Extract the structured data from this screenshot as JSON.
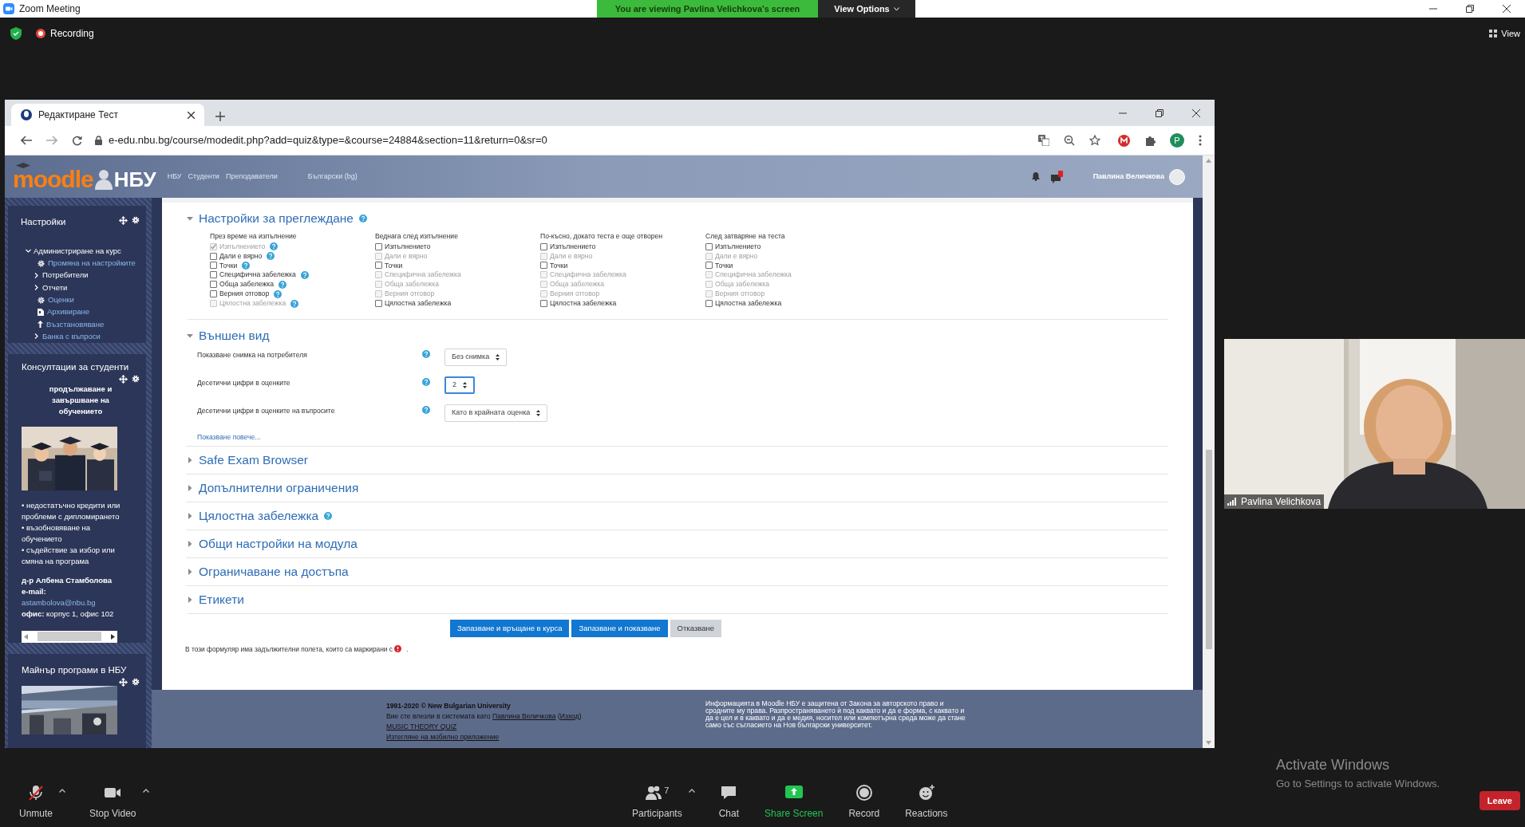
{
  "zoom": {
    "title": "Zoom Meeting",
    "banner": "You are viewing Pavlina Velichkova's screen",
    "view_options": "View Options",
    "recording": "Recording",
    "view": "View"
  },
  "browser": {
    "tab": "Редактиране Тест",
    "url": "e-edu.nbu.bg/course/modedit.php?add=quiz&type=&course=24884&section=11&return=0&sr=0",
    "profile": "P"
  },
  "moodle": {
    "logo": "moodle",
    "logo_suffix": "НБУ",
    "nav": [
      "НБУ",
      "Студенти",
      "Преподаватели"
    ],
    "language": "Български (bg)",
    "user": "Павлина Величкова"
  },
  "sidebar": {
    "settings": {
      "title": "Настройки",
      "root": {
        "label": "Администриране на курс",
        "expanded": true,
        "children": [
          {
            "label": "Промяна на настройките",
            "kind": "settings"
          },
          {
            "label": "Потребители",
            "kind": "branch",
            "linked": false
          },
          {
            "label": "Отчети",
            "kind": "branch",
            "linked": false
          },
          {
            "label": "Оценки",
            "kind": "settings"
          },
          {
            "label": "Архивиране",
            "kind": "backup"
          },
          {
            "label": "Възстановяване",
            "kind": "restore"
          },
          {
            "label": "Банка с въпроси",
            "kind": "branch",
            "linked": true
          }
        ]
      }
    },
    "consult": {
      "title": "Консултации за студенти",
      "heading": "продължаване и завършване на обучението",
      "bullets": [
        "• недостатъчно кредити или проблеми с дипломирането",
        "• възобновяване на обучението",
        "• съдействие за избор или смяна на програма"
      ],
      "name": "д-р Албена Стамболова",
      "email_label": "e-mail:",
      "email": "astambolova@nbu.bg",
      "office": "**офис:** корпус 1, офис 102"
    },
    "minor": {
      "title": "Майнър програми в НБУ"
    }
  },
  "review": {
    "title": "Настройки за преглеждане",
    "expanded": true,
    "help": true,
    "columns": [
      {
        "heading": "През време на изпълнение",
        "items": [
          {
            "label": "Изпълнението",
            "checked": true,
            "disabled": true,
            "help": true
          },
          {
            "label": "Дали е вярно",
            "checked": false,
            "disabled": false,
            "help": true
          },
          {
            "label": "Точки",
            "checked": false,
            "disabled": false,
            "help": true
          },
          {
            "label": "Специфична забележка",
            "checked": false,
            "disabled": false,
            "help": true
          },
          {
            "label": "Обща забележка",
            "checked": false,
            "disabled": false,
            "help": true
          },
          {
            "label": "Верния отговор",
            "checked": false,
            "disabled": false,
            "help": true
          },
          {
            "label": "Цялостна забележка",
            "checked": false,
            "disabled": true,
            "help": true
          }
        ]
      },
      {
        "heading": "Веднага след изпълнение",
        "items": [
          {
            "label": "Изпълнението",
            "checked": false,
            "disabled": false,
            "help": false
          },
          {
            "label": "Дали е вярно",
            "checked": false,
            "disabled": true,
            "help": false
          },
          {
            "label": "Точки",
            "checked": false,
            "disabled": false,
            "help": false
          },
          {
            "label": "Специфична забележка",
            "checked": false,
            "disabled": true,
            "help": false
          },
          {
            "label": "Обща забележка",
            "checked": false,
            "disabled": true,
            "help": false
          },
          {
            "label": "Верния отговор",
            "checked": false,
            "disabled": true,
            "help": false
          },
          {
            "label": "Цялостна забележка",
            "checked": false,
            "disabled": false,
            "help": false
          }
        ]
      },
      {
        "heading": "По-късно, докато теста е още отворен",
        "items": [
          {
            "label": "Изпълнението",
            "checked": false,
            "disabled": false,
            "help": false
          },
          {
            "label": "Дали е вярно",
            "checked": false,
            "disabled": true,
            "help": false
          },
          {
            "label": "Точки",
            "checked": false,
            "disabled": false,
            "help": false
          },
          {
            "label": "Специфична забележка",
            "checked": false,
            "disabled": true,
            "help": false
          },
          {
            "label": "Обща забележка",
            "checked": false,
            "disabled": true,
            "help": false
          },
          {
            "label": "Верния отговор",
            "checked": false,
            "disabled": true,
            "help": false
          },
          {
            "label": "Цялостна забележка",
            "checked": false,
            "disabled": false,
            "help": false
          }
        ]
      },
      {
        "heading": "След затваряне на теста",
        "items": [
          {
            "label": "Изпълнението",
            "checked": false,
            "disabled": false,
            "help": false
          },
          {
            "label": "Дали е вярно",
            "checked": false,
            "disabled": true,
            "help": false
          },
          {
            "label": "Точки",
            "checked": false,
            "disabled": false,
            "help": false
          },
          {
            "label": "Специфична забележка",
            "checked": false,
            "disabled": true,
            "help": false
          },
          {
            "label": "Обща забележка",
            "checked": false,
            "disabled": true,
            "help": false
          },
          {
            "label": "Верния отговор",
            "checked": false,
            "disabled": true,
            "help": false
          },
          {
            "label": "Цялостна забележка",
            "checked": false,
            "disabled": false,
            "help": false
          }
        ]
      }
    ]
  },
  "appearance": {
    "title": "Външен вид",
    "expanded": true,
    "fields": [
      {
        "label": "Показване снимка на потребителя",
        "value": "Без снимка",
        "focused": false
      },
      {
        "label": "Десетични цифри в оценките",
        "value": "2",
        "focused": true
      },
      {
        "label": "Десетични цифри в оценките на въпросите",
        "value": "Като в крайната оценка",
        "focused": false
      }
    ],
    "show_more": "Показване повече..."
  },
  "sections": [
    {
      "title": "Safe Exam Browser",
      "help": false,
      "expanded": false
    },
    {
      "title": "Допълнителни ограничения",
      "help": false,
      "expanded": false
    },
    {
      "title": "Цялостна забележка",
      "help": true,
      "expanded": false
    },
    {
      "title": "Общи настройки на модула",
      "help": false,
      "expanded": false
    },
    {
      "title": "Ограничаване на достъпа",
      "help": false,
      "expanded": false
    },
    {
      "title": "Етикети",
      "help": false,
      "expanded": false
    }
  ],
  "buttons": [
    {
      "label": "Запазване и връщане в курса",
      "kind": "primary"
    },
    {
      "label": "Запазване и показване",
      "kind": "primary"
    },
    {
      "label": "Отказване",
      "kind": "secondary"
    }
  ],
  "required_note": "В този формуляр има задължителни полета, които са маркирани с",
  "required_note_end": ".",
  "footer": {
    "copyright": "1991-2020 © New Bulgarian University",
    "login_prefix": "Вие сте влезли в системата като",
    "login_user": "Павлина Величкова",
    "logout_open": "(",
    "logout": "Изход",
    "logout_close": ")",
    "links": [
      "MUSIC THEORY QUIZ",
      "Изтегляне на мобилно приложение"
    ],
    "notice": "Информацията в Moodle НБУ е защитена от Закона за авторското право и сродните му права. Разпространяването ѝ под каквато и да е форма, с каквато и да е цел и в каквато и да е медия, носител или компютърна среда може да стане само със съгласието на Нов български университет."
  },
  "video": {
    "name": "Pavlina Velichkova"
  },
  "toolbar": {
    "left": [
      {
        "label": "Unmute",
        "kind": "mic",
        "muted": true,
        "menu": true
      },
      {
        "label": "Stop Video",
        "kind": "camera",
        "menu": true
      }
    ],
    "center": [
      {
        "label": "Participants",
        "kind": "participants",
        "count": "7",
        "menu": true
      },
      {
        "label": "Chat",
        "kind": "chat",
        "menu": false
      },
      {
        "label": "Share Screen",
        "kind": "share",
        "menu": false
      },
      {
        "label": "Record",
        "kind": "record",
        "menu": false
      },
      {
        "label": "Reactions",
        "kind": "reactions",
        "menu": false
      }
    ],
    "leave": "Leave"
  },
  "activate": {
    "title": "Activate Windows",
    "subtitle": "Go to Settings to activate Windows."
  }
}
